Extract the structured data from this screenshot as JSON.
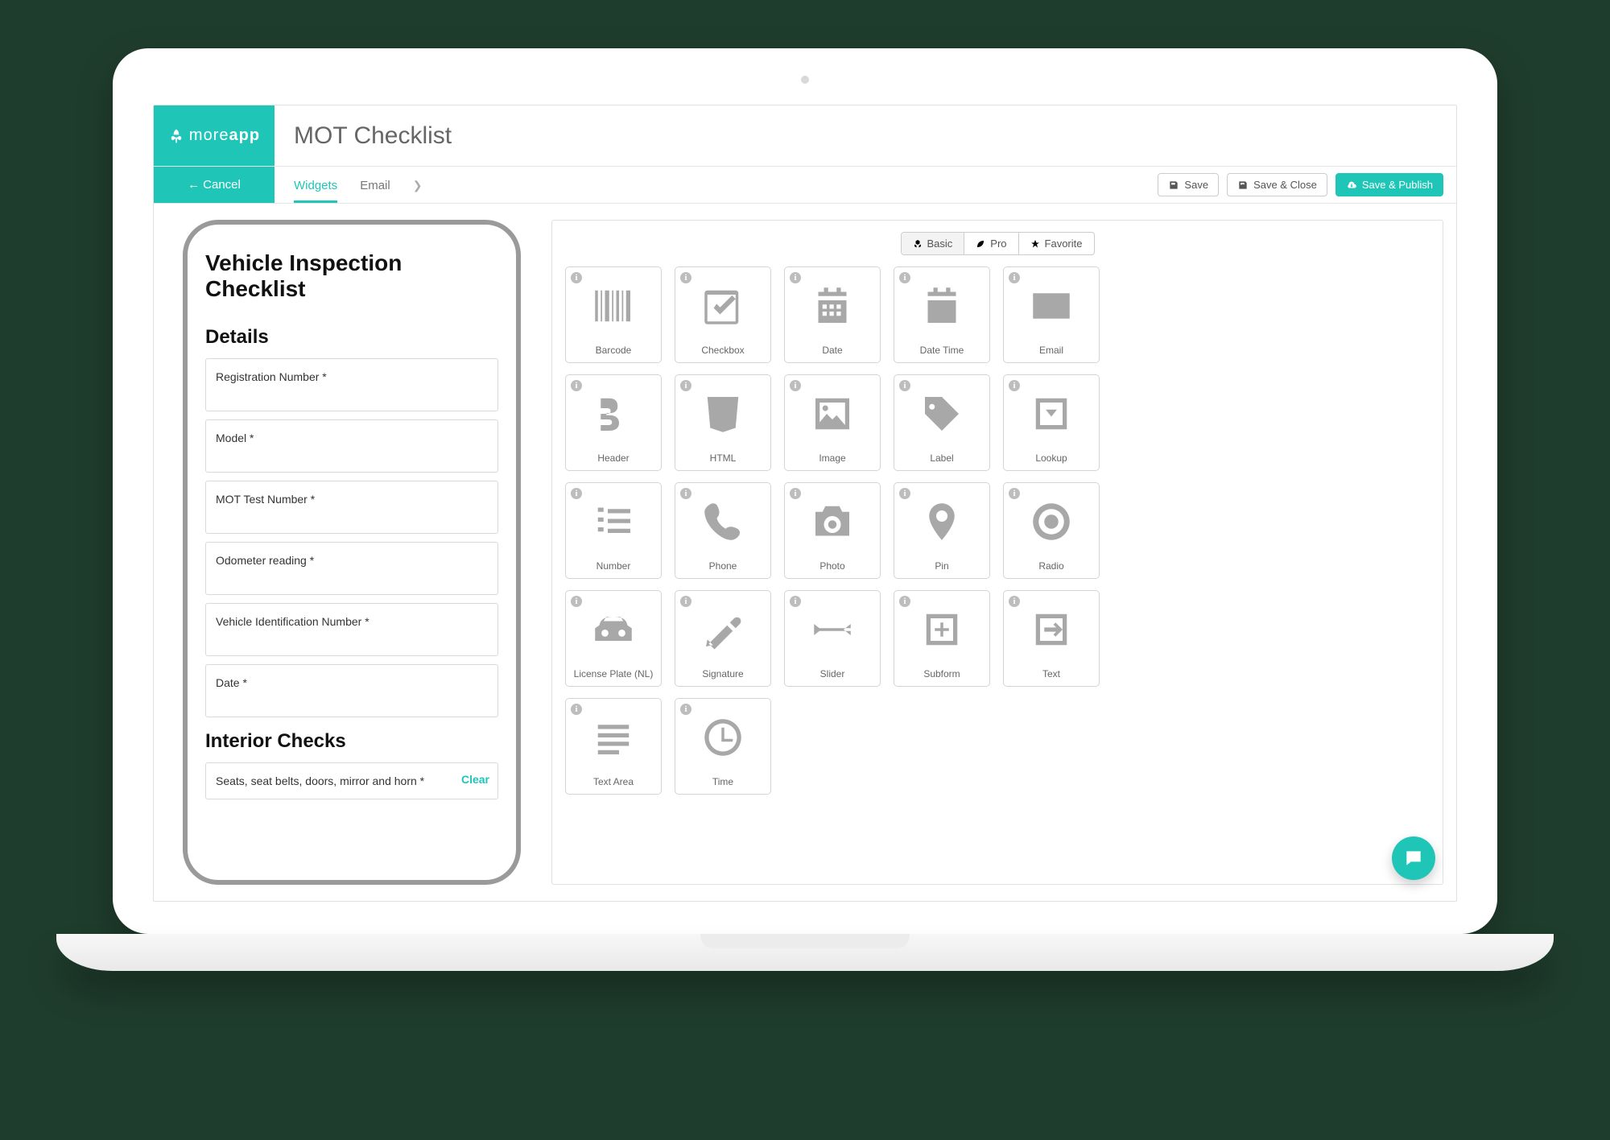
{
  "brand": {
    "name_light": "more",
    "name_bold": "app"
  },
  "header": {
    "title": "MOT Checklist"
  },
  "toolbar": {
    "cancel": "Cancel",
    "tabs": {
      "widgets": "Widgets",
      "email": "Email"
    },
    "save": "Save",
    "save_close": "Save & Close",
    "save_publish": "Save & Publish"
  },
  "preview": {
    "title": "Vehicle Inspection Checklist",
    "section_details": "Details",
    "fields": [
      "Registration Number *",
      "Model *",
      "MOT Test Number *",
      "Odometer reading *",
      "Vehicle Identification Number *",
      "Date *"
    ],
    "section_interior": "Interior Checks",
    "interior_field": "Seats, seat belts, doors, mirror and horn *",
    "clear": "Clear"
  },
  "filters": {
    "basic": "Basic",
    "pro": "Pro",
    "favorite": "Favorite"
  },
  "widgets": [
    {
      "id": "barcode",
      "label": "Barcode"
    },
    {
      "id": "checkbox",
      "label": "Checkbox"
    },
    {
      "id": "date",
      "label": "Date"
    },
    {
      "id": "datetime",
      "label": "Date Time"
    },
    {
      "id": "email",
      "label": "Email"
    },
    {
      "id": "header",
      "label": "Header"
    },
    {
      "id": "html",
      "label": "HTML"
    },
    {
      "id": "image",
      "label": "Image"
    },
    {
      "id": "label",
      "label": "Label"
    },
    {
      "id": "lookup",
      "label": "Lookup"
    },
    {
      "id": "number",
      "label": "Number"
    },
    {
      "id": "phone",
      "label": "Phone"
    },
    {
      "id": "photo",
      "label": "Photo"
    },
    {
      "id": "pin",
      "label": "Pin"
    },
    {
      "id": "radio",
      "label": "Radio"
    },
    {
      "id": "licenseplate",
      "label": "License Plate (NL)"
    },
    {
      "id": "signature",
      "label": "Signature"
    },
    {
      "id": "slider",
      "label": "Slider"
    },
    {
      "id": "subform",
      "label": "Subform"
    },
    {
      "id": "text",
      "label": "Text"
    },
    {
      "id": "textarea",
      "label": "Text Area"
    },
    {
      "id": "time",
      "label": "Time"
    }
  ]
}
